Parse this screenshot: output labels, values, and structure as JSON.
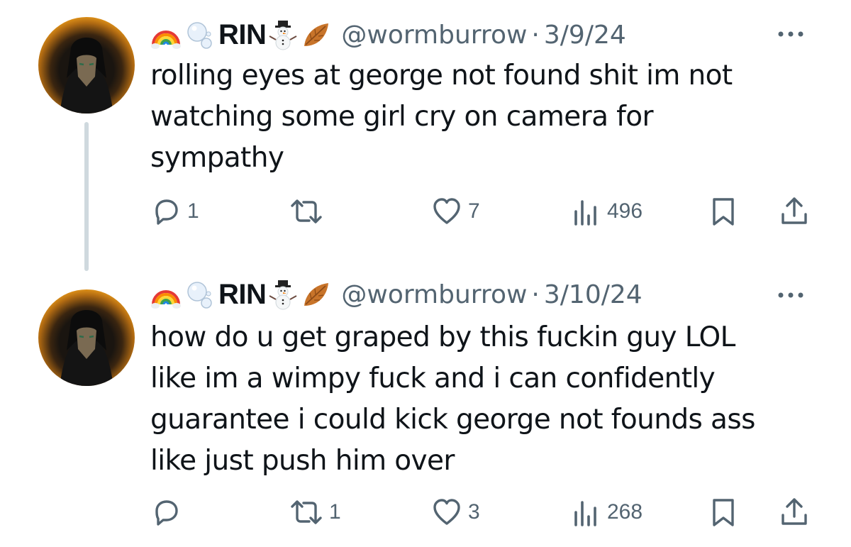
{
  "tweets": [
    {
      "display_name": "RIN",
      "handle": "@wormburrow",
      "separator": "·",
      "date": "3/9/24",
      "text": "rolling eyes at george not found shit im not\nwatching some girl cry on camera for\nsympathy",
      "reply_count": "1",
      "retweet_count": "",
      "like_count": "7",
      "view_count": "496"
    },
    {
      "display_name": "RIN",
      "handle": "@wormburrow",
      "separator": "·",
      "date": "3/10/24",
      "text": "how do u get graped by this fuckin guy LOL\nlike im a wimpy fuck and i can confidently\nguarantee i could kick george not founds ass\nlike just push him over",
      "reply_count": "",
      "retweet_count": "1",
      "like_count": "3",
      "view_count": "268"
    }
  ],
  "name_emojis": [
    "rainbow",
    "bubbles",
    "snowman",
    "fallen-leaf"
  ],
  "icons": [
    "more-icon",
    "reply-icon",
    "retweet-icon",
    "like-icon",
    "views-icon",
    "bookmark-icon",
    "share-icon"
  ],
  "colors": {
    "text": "#0f1419",
    "secondary": "#536471",
    "thread_line": "#cfd9de",
    "background": "#ffffff"
  }
}
